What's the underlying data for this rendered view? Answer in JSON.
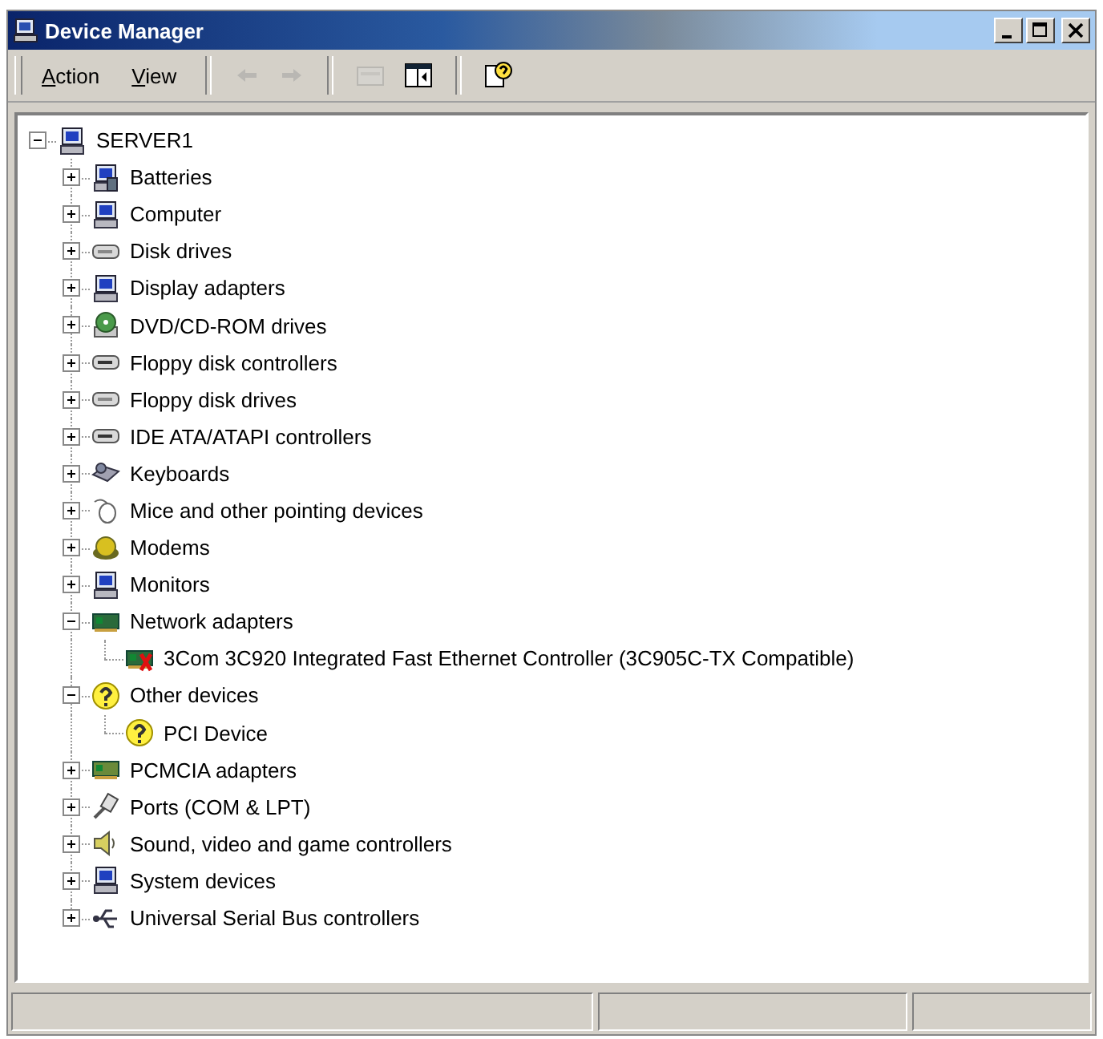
{
  "window": {
    "title": "Device Manager"
  },
  "menu": [
    {
      "label": "Action"
    },
    {
      "label": "View"
    }
  ],
  "toolbar": [
    {
      "kind": "back",
      "disabled": true
    },
    {
      "kind": "forward",
      "disabled": true
    },
    {
      "kind": "up",
      "disabled": true
    },
    {
      "kind": "tree",
      "disabled": false
    },
    {
      "kind": "help",
      "disabled": false
    }
  ],
  "tree": [
    {
      "label": "SERVER1",
      "expanded": true,
      "children": [
        {
          "label": "Batteries",
          "expanded": false
        },
        {
          "label": "Computer",
          "expanded": false
        },
        {
          "label": "Disk drives",
          "expanded": false
        },
        {
          "label": "Display adapters",
          "expanded": false
        },
        {
          "label": "DVD/CD-ROM drives",
          "expanded": false
        },
        {
          "label": "Floppy disk controllers",
          "expanded": false
        },
        {
          "label": "Floppy disk drives",
          "expanded": false
        },
        {
          "label": "IDE ATA/ATAPI controllers",
          "expanded": false
        },
        {
          "label": "Keyboards",
          "expanded": false
        },
        {
          "label": "Mice and other pointing devices",
          "expanded": false
        },
        {
          "label": "Modems",
          "expanded": false
        },
        {
          "label": "Monitors",
          "expanded": false
        },
        {
          "label": "Network adapters",
          "expanded": true,
          "children": [
            {
              "label": "3Com 3C920 Integrated Fast Ethernet Controller (3C905C-TX Compatible)"
            }
          ]
        },
        {
          "label": "Other devices",
          "expanded": true,
          "children": [
            {
              "label": "PCI Device"
            }
          ]
        },
        {
          "label": "PCMCIA adapters",
          "expanded": false
        },
        {
          "label": "Ports (COM & LPT)",
          "expanded": false
        },
        {
          "label": "Sound, video and game controllers",
          "expanded": false
        },
        {
          "label": "System devices",
          "expanded": false
        },
        {
          "label": "Universal Serial Bus controllers",
          "expanded": false
        }
      ]
    }
  ]
}
